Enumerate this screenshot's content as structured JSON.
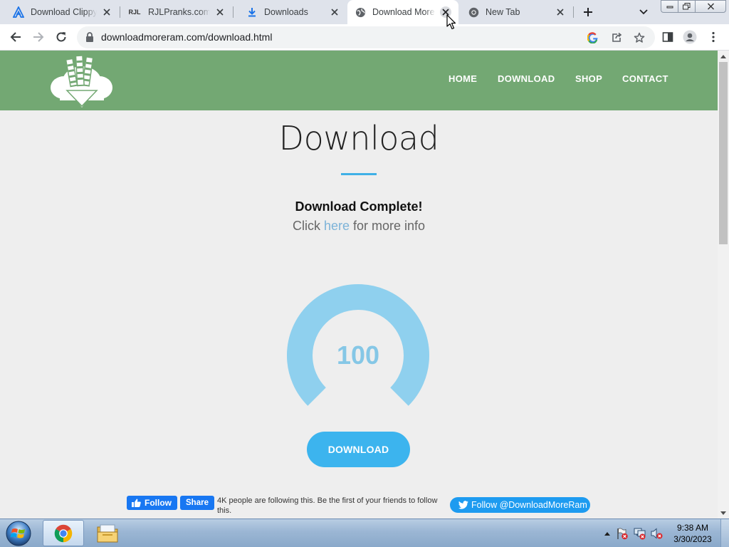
{
  "browser": {
    "tabs": [
      {
        "title": "Download Clippy",
        "icon": "clippy-a-icon",
        "active": false
      },
      {
        "title": "RJLPranks.com - C",
        "icon": "rjl-logo-icon",
        "active": false
      },
      {
        "title": "Downloads",
        "icon": "download-arrow-icon",
        "active": false
      },
      {
        "title": "Download More R",
        "icon": "globe-icon",
        "active": true
      },
      {
        "title": "New Tab",
        "icon": "chrome-icon",
        "active": false
      }
    ],
    "url": "downloadmoreram.com/download.html"
  },
  "site": {
    "nav": [
      "HOME",
      "DOWNLOAD",
      "SHOP",
      "CONTACT"
    ],
    "page_title": "Download",
    "status_heading": "Download Complete!",
    "info_prefix": "Click ",
    "info_link": "here",
    "info_suffix": " for more info",
    "gauge_value": "100",
    "gauge_fraction": 1.0,
    "download_button": "DOWNLOAD",
    "facebook": {
      "follow_label": "Follow",
      "share_label": "Share",
      "text": "4K people are following this. Be the first of your friends to follow this."
    },
    "twitter_follow": "Follow @DownloadMoreRam"
  },
  "colors": {
    "header_green": "#73a873",
    "gauge_blue": "#8fd0ee",
    "button_blue": "#3cb4ee",
    "accent_rule": "#3fb0e6"
  },
  "taskbar": {
    "time": "9:38 AM",
    "date": "3/30/2023"
  }
}
